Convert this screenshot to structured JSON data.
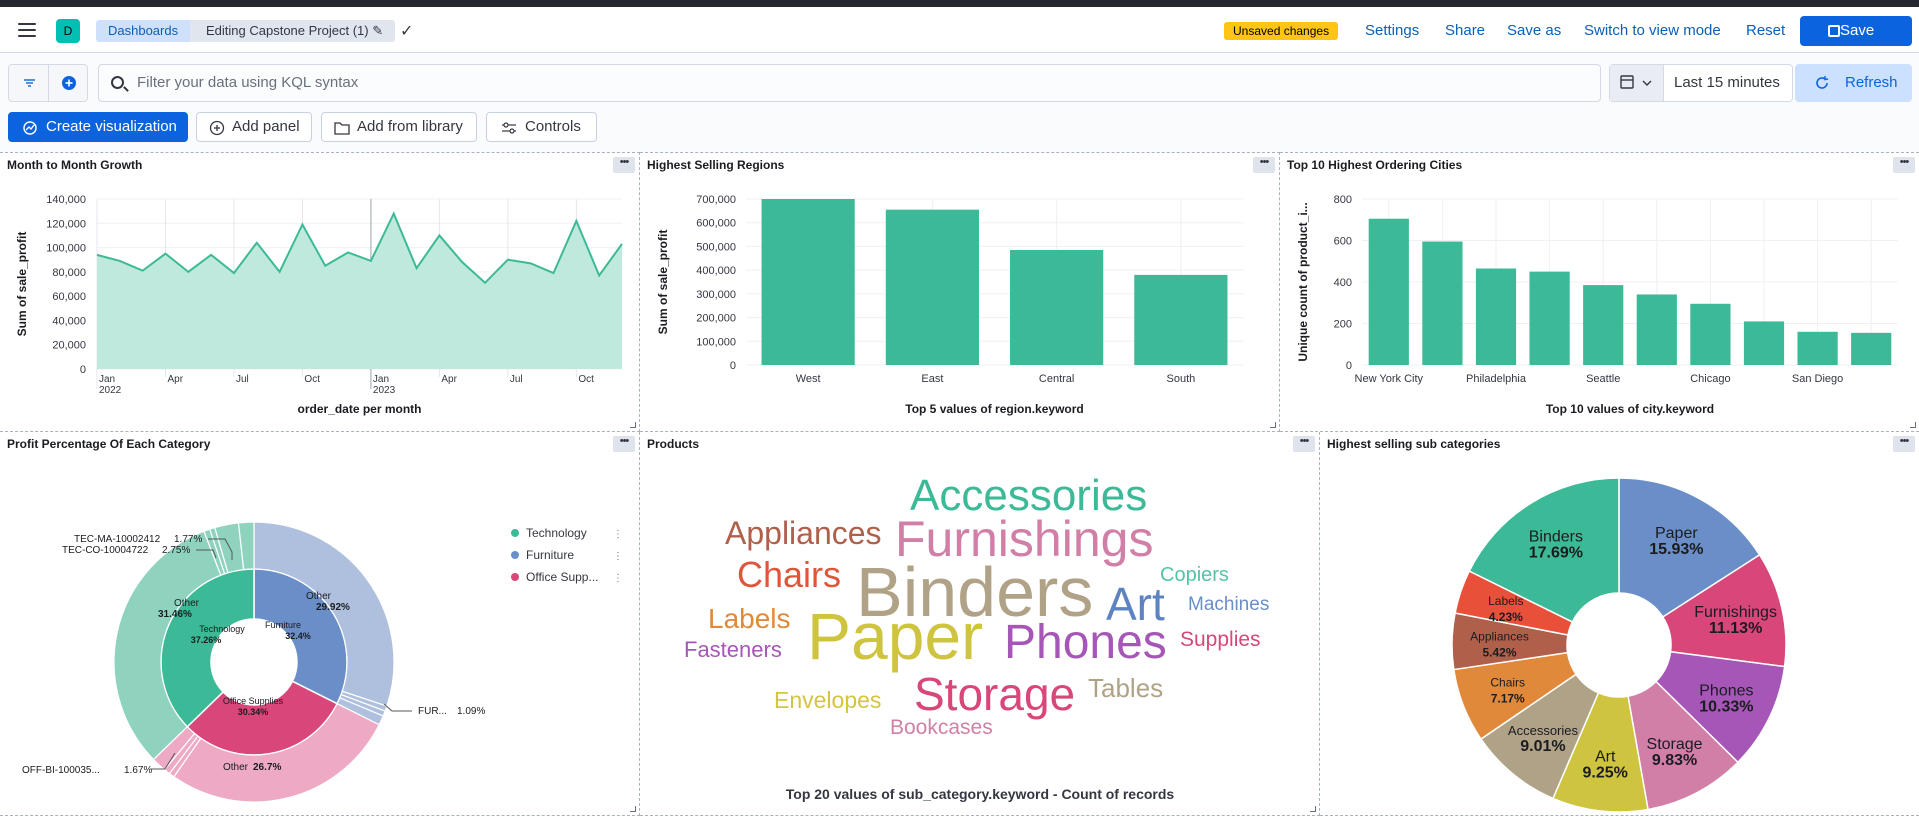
{
  "header": {
    "space_initial": "D",
    "breadcrumb_root": "Dashboards",
    "breadcrumb_current": "Editing Capstone Project (1)",
    "unsaved_badge": "Unsaved changes",
    "settings": "Settings",
    "share": "Share",
    "save_as": "Save as",
    "switch_mode": "Switch to view mode",
    "reset": "Reset",
    "save": "Save"
  },
  "query": {
    "placeholder": "Filter your data using KQL syntax",
    "time_range": "Last 15 minutes",
    "refresh": "Refresh"
  },
  "toolbar": {
    "create_visualization": "Create visualization",
    "add_panel": "Add panel",
    "add_from_library": "Add from library",
    "controls": "Controls"
  },
  "colors": {
    "teal": "#3cb996",
    "teal_light": "#bfe9dc",
    "blue": "#6a8ec7",
    "pink": "#d8467a",
    "accent": "#0b64dd"
  },
  "panels": {
    "growth": {
      "title": "Month to Month Growth",
      "chart_data": {
        "type": "area",
        "xlabel": "order_date per month",
        "ylabel": "Sum of sale_profit",
        "ylim": [
          0,
          140000
        ],
        "y_ticks": [
          "140,000",
          "120,000",
          "100,000",
          "80,000",
          "60,000",
          "40,000",
          "20,000",
          "0"
        ],
        "x_ticks": [
          {
            "label": "Jan",
            "sub": "2022"
          },
          {
            "label": "Apr",
            "sub": ""
          },
          {
            "label": "Jul",
            "sub": ""
          },
          {
            "label": "Oct",
            "sub": ""
          },
          {
            "label": "Jan",
            "sub": "2023"
          },
          {
            "label": "Apr",
            "sub": ""
          },
          {
            "label": "Jul",
            "sub": ""
          },
          {
            "label": "Oct",
            "sub": ""
          }
        ],
        "x": [
          "2022-01",
          "2022-02",
          "2022-03",
          "2022-04",
          "2022-05",
          "2022-06",
          "2022-07",
          "2022-08",
          "2022-09",
          "2022-10",
          "2022-11",
          "2022-12",
          "2023-01",
          "2023-02",
          "2023-03",
          "2023-04",
          "2023-05",
          "2023-06",
          "2023-07",
          "2023-08",
          "2023-09",
          "2023-10",
          "2023-11",
          "2023-12"
        ],
        "values": [
          94000,
          89000,
          81000,
          95000,
          80000,
          94000,
          79000,
          104000,
          80000,
          119000,
          85000,
          96000,
          89000,
          128000,
          83000,
          110000,
          88000,
          71000,
          90000,
          87000,
          79000,
          122000,
          77000,
          103000
        ],
        "grid": true
      }
    },
    "regions": {
      "title": "Highest Selling Regions",
      "chart_data": {
        "type": "bar",
        "categories": [
          "West",
          "East",
          "Central",
          "South"
        ],
        "values": [
          700000,
          655000,
          485000,
          380000
        ],
        "xlabel": "Top 5 values of region.keyword",
        "ylabel": "Sum of sale_profit",
        "ylim": [
          0,
          700000
        ],
        "y_ticks": [
          "700,000",
          "600,000",
          "500,000",
          "400,000",
          "300,000",
          "200,000",
          "100,000",
          "0"
        ],
        "grid": true
      }
    },
    "cities": {
      "title": "Top 10 Highest Ordering Cities",
      "chart_data": {
        "type": "bar",
        "categories": [
          "New York City",
          "",
          "Philadelphia",
          "",
          "Seattle",
          "",
          "Chicago",
          "",
          "San Diego",
          ""
        ],
        "values": [
          705,
          595,
          465,
          450,
          385,
          340,
          295,
          210,
          160,
          155
        ],
        "xlabel": "Top 10 values of city.keyword",
        "ylabel": "Unique count of product_i...",
        "ylim": [
          0,
          800
        ],
        "y_ticks": [
          "800",
          "600",
          "400",
          "200",
          "0"
        ],
        "grid": true
      }
    },
    "category": {
      "title": "Profit Percentage Of Each Category",
      "legend": [
        "Technology",
        "Furniture",
        "Office Supp..."
      ],
      "chart_data": {
        "type": "pie",
        "inner": [
          {
            "name": "Technology",
            "value": 37.26,
            "label": "37.26%"
          },
          {
            "name": "Furniture",
            "value": 32.4,
            "label": "32.4%"
          },
          {
            "name": "Office Supplies",
            "value": 30.34,
            "label": "30.34%"
          }
        ],
        "outer_labels": {
          "tec_ma": "TEC-MA-10002412",
          "tec_ma_val": "1.77%",
          "tec_co": "TEC-CO-10004722",
          "tec_co_val": "2.75%",
          "other_tech": "Other",
          "other_tech_val": "31.46%",
          "other_furn": "Other",
          "other_furn_val": "29.92%",
          "fur": "FUR...",
          "fur_val": "1.09%",
          "off": "OFF-BI-100035...",
          "off_val": "1.67%",
          "other_off": "Other",
          "other_off_val": "26.7%"
        }
      }
    },
    "products": {
      "title": "Products",
      "caption": "Top 20 values of sub_category.keyword - Count of records",
      "words": [
        "Accessories",
        "Appliances",
        "Furnishings",
        "Chairs",
        "Copiers",
        "Binders",
        "Art",
        "Machines",
        "Labels",
        "Supplies",
        "Paper",
        "Phones",
        "Fasteners",
        "Storage",
        "Tables",
        "Envelopes",
        "Bookcases"
      ]
    },
    "subcategories": {
      "title": "Highest selling sub categories",
      "chart_data": {
        "type": "pie",
        "slices": [
          {
            "name": "Paper",
            "value": 15.93,
            "label": "15.93%"
          },
          {
            "name": "Furnishings",
            "value": 11.13,
            "label": "11.13%"
          },
          {
            "name": "Phones",
            "value": 10.33,
            "label": "10.33%"
          },
          {
            "name": "Storage",
            "value": 9.83,
            "label": "9.83%"
          },
          {
            "name": "Art",
            "value": 9.25,
            "label": "9.25%"
          },
          {
            "name": "Accessories",
            "value": 9.01,
            "label": "9.01%"
          },
          {
            "name": "Chairs",
            "value": 7.17,
            "label": "7.17%"
          },
          {
            "name": "Appliances",
            "value": 5.42,
            "label": "5.42%"
          },
          {
            "name": "Labels",
            "value": 4.23,
            "label": "4.23%"
          },
          {
            "name": "Binders",
            "value": 17.69,
            "label": "17.69%"
          }
        ]
      }
    }
  }
}
